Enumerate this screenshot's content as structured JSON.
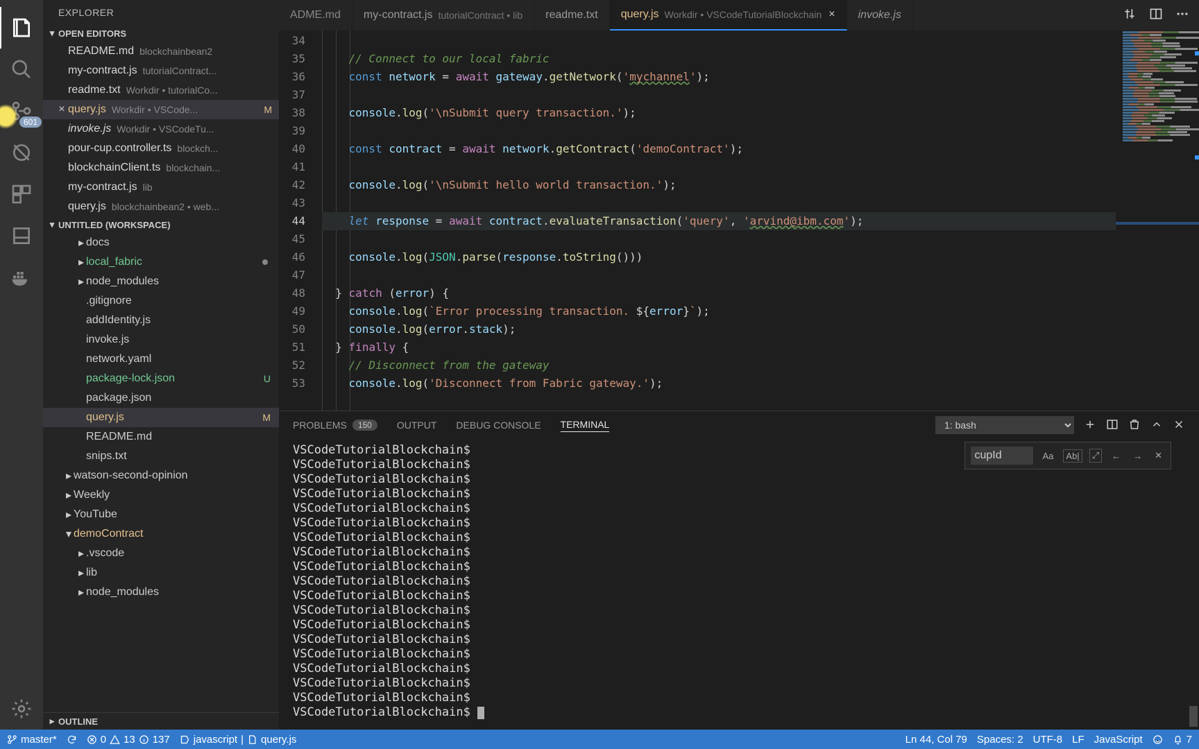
{
  "sidebar": {
    "title": "EXPLORER",
    "sections": {
      "openEditors": "OPEN EDITORS",
      "workspace": "UNTITLED (WORKSPACE)",
      "outline": "OUTLINE"
    }
  },
  "activityBar": {
    "scmBadge": "601"
  },
  "openEditors": [
    {
      "name": "README.md",
      "desc": "blockchainbean2",
      "modified": false
    },
    {
      "name": "my-contract.js",
      "desc": "tutorialContract...",
      "modified": false
    },
    {
      "name": "readme.txt",
      "desc": "Workdir • tutorialCo...",
      "modified": false
    },
    {
      "name": "query.js",
      "desc": "Workdir • VSCode...",
      "modified": true,
      "active": true,
      "badge": "M"
    },
    {
      "name": "invoke.js",
      "desc": "Workdir • VSCodeTu...",
      "modified": false,
      "italic": true
    },
    {
      "name": "pour-cup.controller.ts",
      "desc": "blockch...",
      "modified": false
    },
    {
      "name": "blockchainClient.ts",
      "desc": "blockchain...",
      "modified": false
    },
    {
      "name": "my-contract.js",
      "desc": "lib",
      "modified": false
    },
    {
      "name": "query.js",
      "desc": "blockchainbean2 • web...",
      "modified": false
    }
  ],
  "fileTree": [
    {
      "depth": 1,
      "kind": "folder",
      "name": "docs",
      "expanded": false
    },
    {
      "depth": 1,
      "kind": "folder",
      "name": "local_fabric",
      "expanded": false,
      "status": "dot",
      "class": "added"
    },
    {
      "depth": 1,
      "kind": "folder",
      "name": "node_modules",
      "expanded": false
    },
    {
      "depth": 1,
      "kind": "file",
      "name": ".gitignore"
    },
    {
      "depth": 1,
      "kind": "file",
      "name": "addIdentity.js"
    },
    {
      "depth": 1,
      "kind": "file",
      "name": "invoke.js"
    },
    {
      "depth": 1,
      "kind": "file",
      "name": "network.yaml"
    },
    {
      "depth": 1,
      "kind": "file",
      "name": "package-lock.json",
      "status": "U",
      "class": "added"
    },
    {
      "depth": 1,
      "kind": "file",
      "name": "package.json"
    },
    {
      "depth": 1,
      "kind": "file",
      "name": "query.js",
      "status": "M",
      "class": "mod",
      "selected": true
    },
    {
      "depth": 1,
      "kind": "file",
      "name": "README.md"
    },
    {
      "depth": 1,
      "kind": "file",
      "name": "snips.txt"
    },
    {
      "depth": 0,
      "kind": "folder",
      "name": "watson-second-opinion",
      "expanded": false
    },
    {
      "depth": 0,
      "kind": "folder",
      "name": "Weekly",
      "expanded": false
    },
    {
      "depth": 0,
      "kind": "folder",
      "name": "YouTube",
      "expanded": false
    },
    {
      "depth": 0,
      "kind": "folder",
      "name": "demoContract",
      "expanded": true,
      "class": "mod"
    },
    {
      "depth": 1,
      "kind": "folder",
      "name": ".vscode",
      "expanded": false
    },
    {
      "depth": 1,
      "kind": "folder",
      "name": "lib",
      "expanded": false
    },
    {
      "depth": 1,
      "kind": "folder",
      "name": "node_modules",
      "expanded": false
    }
  ],
  "tabs": [
    {
      "label": "ADME.md",
      "partial": true
    },
    {
      "label": "my-contract.js",
      "desc": "tutorialContract • lib"
    },
    {
      "label": "readme.txt"
    },
    {
      "label": "query.js",
      "desc": "Workdir • VSCodeTutorialBlockchain",
      "active": true,
      "close": "×"
    },
    {
      "label": "invoke.js",
      "italic": true
    }
  ],
  "editor": {
    "startLine": 34,
    "currentLine": 44,
    "lines": [
      {
        "n": 34,
        "html": ""
      },
      {
        "n": 35,
        "html": "    <span class='tok-comment'>// Connect to our local fabric</span>"
      },
      {
        "n": 36,
        "html": "    <span class='tok-kw'>const</span> <span class='tok-var'>network</span> <span class='tok-plain'>=</span> <span class='tok-ctrl'>await</span> <span class='tok-var'>gateway</span><span class='tok-plain'>.</span><span class='tok-call'>getNetwork</span><span class='tok-plain'>(</span><span class='tok-str'>'<span class='squiggle'>mychannel</span>'</span><span class='tok-plain'>);</span>"
      },
      {
        "n": 37,
        "html": ""
      },
      {
        "n": 38,
        "html": "    <span class='tok-var'>console</span><span class='tok-plain'>.</span><span class='tok-call'>log</span><span class='tok-plain'>(</span><span class='tok-str'>'\\nSubmit query transaction.'</span><span class='tok-plain'>);</span>"
      },
      {
        "n": 39,
        "html": ""
      },
      {
        "n": 40,
        "html": "    <span class='tok-kw'>const</span> <span class='tok-var'>contract</span> <span class='tok-plain'>=</span> <span class='tok-ctrl'>await</span> <span class='tok-var'>network</span><span class='tok-plain'>.</span><span class='tok-call'>getContract</span><span class='tok-plain'>(</span><span class='tok-str'>'demoContract'</span><span class='tok-plain'>);</span>"
      },
      {
        "n": 41,
        "html": ""
      },
      {
        "n": 42,
        "html": "    <span class='tok-var'>console</span><span class='tok-plain'>.</span><span class='tok-call'>log</span><span class='tok-plain'>(</span><span class='tok-str'>'\\nSubmit hello world transaction.'</span><span class='tok-plain'>);</span>"
      },
      {
        "n": 43,
        "html": ""
      },
      {
        "n": 44,
        "html": "    <span class='tok-kw-it'>let</span> <span class='tok-var'>response</span> <span class='tok-plain'>=</span> <span class='tok-ctrl'>await</span> <span class='tok-var'>contract</span><span class='tok-plain'>.</span><span class='tok-call'>evaluateTransaction</span><span class='tok-plain'>(</span><span class='tok-str'>'query'</span><span class='tok-plain'>, </span><span class='tok-str'>'<span class='squiggle'>arvind@ibm.com</span>'</span><span class='tok-plain'>);</span>"
      },
      {
        "n": 45,
        "html": ""
      },
      {
        "n": 46,
        "html": "    <span class='tok-var'>console</span><span class='tok-plain'>.</span><span class='tok-call'>log</span><span class='tok-plain'>(</span><span class='tok-type'>JSON</span><span class='tok-plain'>.</span><span class='tok-call'>parse</span><span class='tok-plain'>(</span><span class='tok-var'>response</span><span class='tok-plain'>.</span><span class='tok-call'>toString</span><span class='tok-plain'>()))</span>"
      },
      {
        "n": 47,
        "html": ""
      },
      {
        "n": 48,
        "html": "  <span class='tok-plain'>}</span> <span class='tok-ctrl'>catch</span> <span class='tok-plain'>(</span><span class='tok-var'>error</span><span class='tok-plain'>) {</span>"
      },
      {
        "n": 49,
        "html": "    <span class='tok-var'>console</span><span class='tok-plain'>.</span><span class='tok-call'>log</span><span class='tok-plain'>(</span><span class='tok-str'>`Error processing transaction. <span class='tok-plain'>${</span><span class='tok-var'>error</span><span class='tok-plain'>}</span>`</span><span class='tok-plain'>);</span>"
      },
      {
        "n": 50,
        "html": "    <span class='tok-var'>console</span><span class='tok-plain'>.</span><span class='tok-call'>log</span><span class='tok-plain'>(</span><span class='tok-var'>error</span><span class='tok-plain'>.</span><span class='tok-var'>stack</span><span class='tok-plain'>);</span>"
      },
      {
        "n": 51,
        "html": "  <span class='tok-plain'>}</span> <span class='tok-ctrl'>finally</span> <span class='tok-plain'>{</span>"
      },
      {
        "n": 52,
        "html": "    <span class='tok-comment'>// Disconnect from the gateway</span>"
      },
      {
        "n": 53,
        "html": "    <span class='tok-var'>console</span><span class='tok-plain'>.</span><span class='tok-call'>log</span><span class='tok-plain'>(</span><span class='tok-str'>'Disconnect from Fabric gateway.'</span><span class='tok-plain'>);</span>"
      }
    ]
  },
  "panel": {
    "tabs": {
      "problems": "PROBLEMS",
      "problemsCount": "150",
      "output": "OUTPUT",
      "debug": "DEBUG CONSOLE",
      "terminal": "TERMINAL"
    },
    "terminalSelect": "1: bash",
    "find": {
      "value": "cupId",
      "caseLabel": "Aa",
      "wordLabel": "Ab|",
      "regexLabel": "⤢"
    },
    "terminalPrompt": "VSCodeTutorialBlockchain$",
    "terminalLineCount": 19
  },
  "statusbar": {
    "branch": "master*",
    "errors": "0",
    "warnings": "13",
    "info": "137",
    "lang1": "javascript",
    "file": "query.js",
    "position": "Ln 44, Col 79",
    "spaces": "Spaces: 2",
    "encoding": "UTF-8",
    "eol": "LF",
    "language": "JavaScript",
    "bell": "7"
  }
}
